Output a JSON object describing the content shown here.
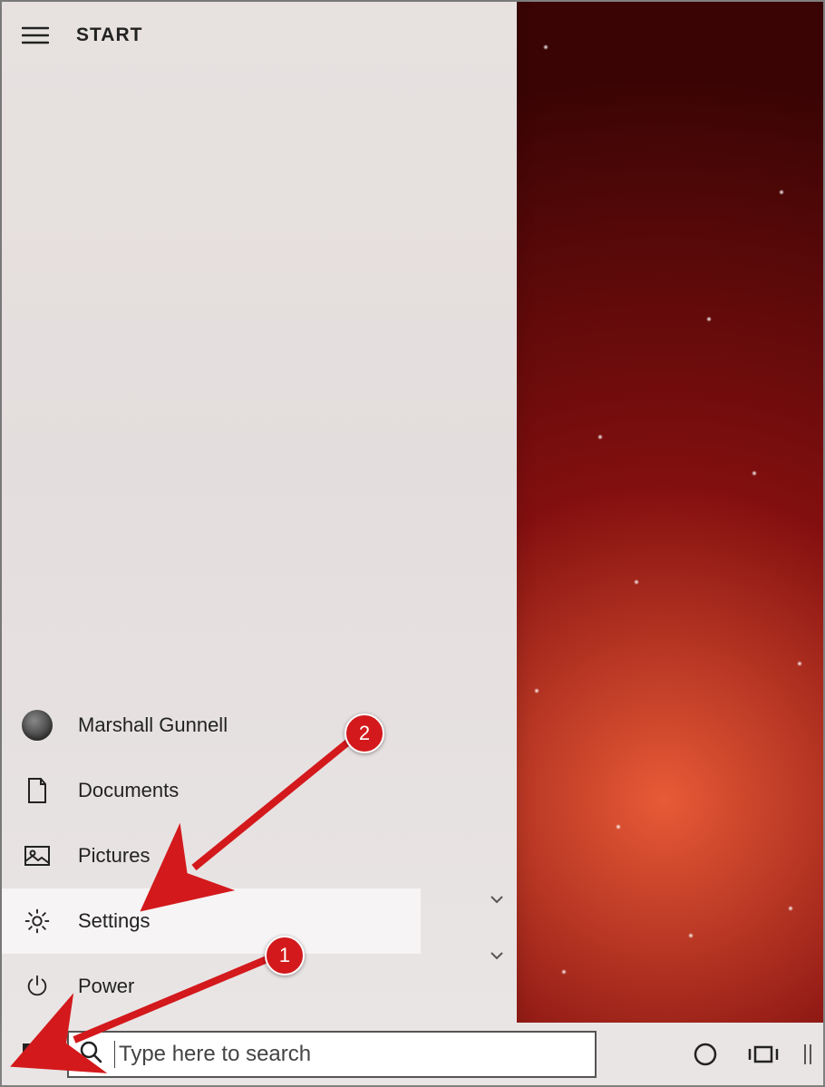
{
  "start": {
    "title": "START",
    "items": [
      {
        "label": "Marshall Gunnell",
        "icon": "avatar"
      },
      {
        "label": "Documents",
        "icon": "document"
      },
      {
        "label": "Pictures",
        "icon": "pictures"
      },
      {
        "label": "Settings",
        "icon": "gear"
      },
      {
        "label": "Power",
        "icon": "power"
      }
    ]
  },
  "taskbar": {
    "search_placeholder": "Type here to search",
    "icons": [
      "start",
      "cortana-circle",
      "task-view",
      "divider"
    ]
  },
  "annotations": [
    {
      "num": "1"
    },
    {
      "num": "2"
    }
  ]
}
